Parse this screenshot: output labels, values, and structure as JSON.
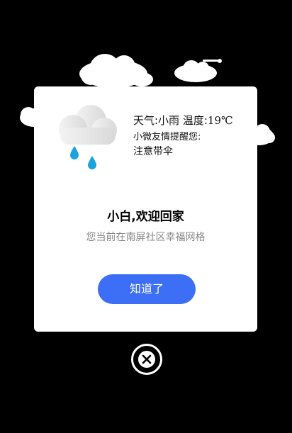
{
  "weather": {
    "label": "天气:小雨",
    "temperature_prefix": "温度:",
    "temperature_value": "19℃",
    "reminder_title": "小微友情提醒您:",
    "reminder_text": "注意带伞",
    "icon": "cloud-rain-icon"
  },
  "welcome": {
    "title": "小白,欢迎回家",
    "location": "您当前在南屏社区幸福网格"
  },
  "actions": {
    "confirm_label": "知道了",
    "close_icon": "close-circle-icon"
  },
  "colors": {
    "background": "#000000",
    "card": "#ffffff",
    "accent": "#3d6ff6",
    "raindrop": "#1aa3dd",
    "secondary_text": "#888888"
  }
}
